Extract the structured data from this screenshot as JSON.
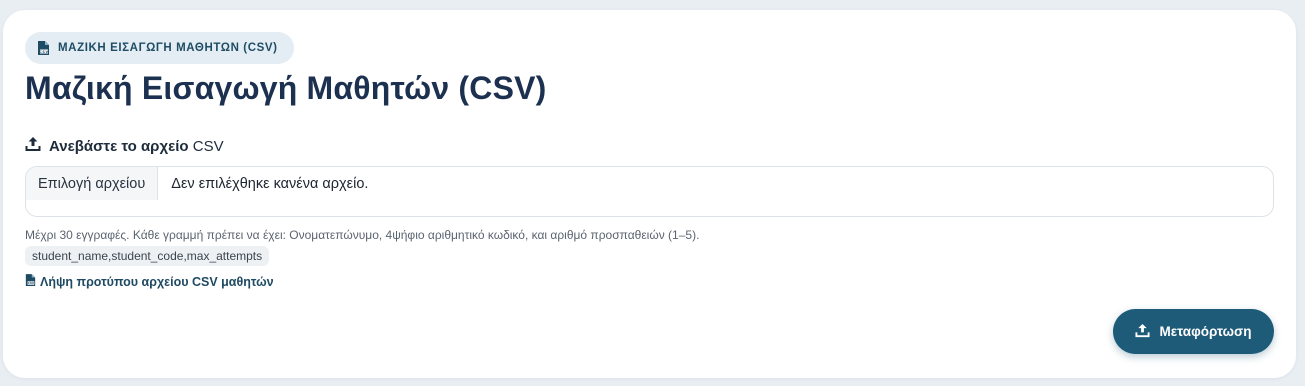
{
  "badge": {
    "label": "ΜΑΖΙΚΗ ΕΙΣΑΓΩΓΗ ΜΑΘΗΤΩΝ (CSV)",
    "icon": "csv-file-icon"
  },
  "page_title": "Μαζική Εισαγωγή Μαθητών (CSV)",
  "upload_section": {
    "label_bold": "Ανεβάστε το αρχείο",
    "label_rest": " CSV",
    "icon": "upload-icon"
  },
  "file_input": {
    "button_label": "Επιλογή αρχείου",
    "status_text": "Δεν επιλέχθηκε κανένα αρχείο."
  },
  "hint": "Μέχρι 30 εγγραφές. Κάθε γραμμή πρέπει να έχει: Ονοματεπώνυμο, 4ψήφιο αριθμητικό κωδικό, και αριθμό προσπαθειών (1–5).",
  "csv_header_example": "student_name,student_code,max_attempts",
  "download_template": {
    "label": "Λήψη προτύπου αρχείου CSV μαθητών",
    "icon": "csv-file-icon"
  },
  "submit_button": {
    "label": "Μεταφόρτωση",
    "icon": "upload-icon"
  },
  "colors": {
    "primary": "#1e5b78",
    "title": "#1c3050",
    "badge_bg": "#e3edf3",
    "page_bg": "#e9eef3"
  }
}
